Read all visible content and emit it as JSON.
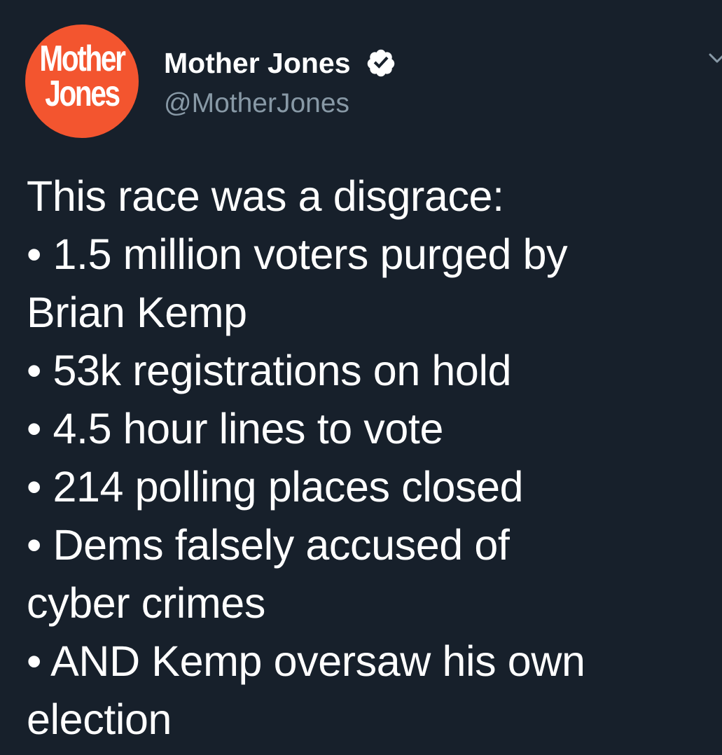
{
  "author": {
    "avatar_line1": "Mother",
    "avatar_line2": "Jones",
    "name": "Mother Jones",
    "handle": "@MotherJones",
    "verified": true,
    "avatar_color": "#f3552f",
    "verified_icon": "verified-badge-icon"
  },
  "menu": {
    "icon": "chevron-down-icon"
  },
  "tweet": {
    "lines": [
      "This race was a disgrace:",
      "• 1.5 million voters purged by",
      "Brian Kemp",
      "• 53k registrations on hold",
      "• 4.5 hour lines to vote",
      "• 214 polling places closed",
      "• Dems falsely accused of",
      "cyber crimes",
      "• AND Kemp oversaw his own",
      "election"
    ]
  },
  "colors": {
    "background": "#17202b",
    "text": "#ffffff",
    "secondary_text": "#8899a6"
  }
}
